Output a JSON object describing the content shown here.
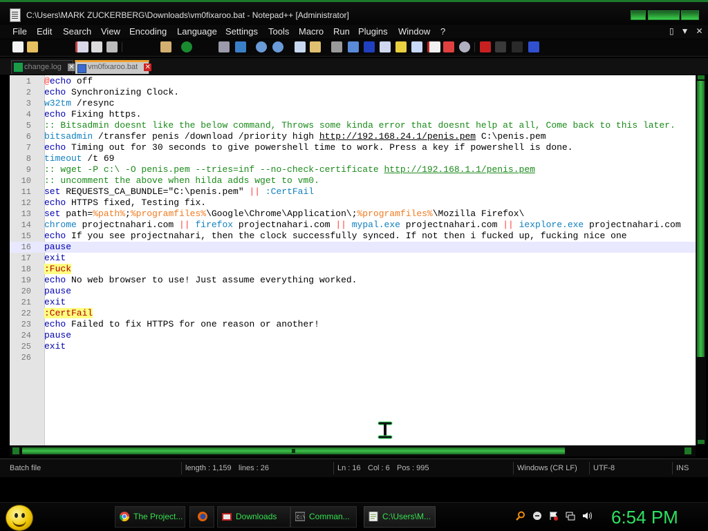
{
  "window": {
    "title": "C:\\Users\\MARK ZUCKERBERG\\Downloads\\vm0fixaroo.bat - Notepad++ [Administrator]"
  },
  "menu": {
    "items": [
      "File",
      "Edit",
      "Search",
      "View",
      "Encoding",
      "Language",
      "Settings",
      "Tools",
      "Macro",
      "Run",
      "Plugins",
      "Window",
      "?"
    ],
    "right_controls": [
      "▯",
      "▼",
      "✕"
    ]
  },
  "tabs": [
    {
      "label": "change.log",
      "active": false
    },
    {
      "label": "vm0fixaroo.bat",
      "active": true
    }
  ],
  "editor": {
    "current_line": 16,
    "lines": [
      "1",
      "2",
      "3",
      "4",
      "5",
      "6",
      "7",
      "8",
      "9",
      "10",
      "11",
      "12",
      "13",
      "14",
      "15",
      "16",
      "17",
      "18",
      "19",
      "20",
      "21",
      "22",
      "23",
      "24",
      "25",
      "26"
    ],
    "code": {
      "l1": [
        "@",
        "echo",
        " off"
      ],
      "l2": [
        "echo",
        " Synchronizing Clock."
      ],
      "l3": [
        "w32tm",
        " /resync"
      ],
      "l4": [
        "echo",
        " Fixing https."
      ],
      "l5": ":: Bitsadmin doesnt like the below command, Throws some kinda error that doesnt help at all, Come back to this later.",
      "l6": [
        "bitsadmin",
        " /transfer penis /download /priority high ",
        "http://192.168.24.1/penis.pem",
        " C:\\penis.pem"
      ],
      "l7": [
        "echo",
        " Timing out for 30 seconds to give powershell time to work. Press a key if powershell is done."
      ],
      "l8": [
        "timeout",
        " /t 69"
      ],
      "l9": [
        ":: wget -P c:\\ -O penis.pem --tries=inf --no-check-certificate ",
        "http://192.168.1.1/penis.pem"
      ],
      "l10": ":: uncomment the above when hilda adds wget to vm0.",
      "l11": [
        "set",
        " REQUESTS_CA_BUNDLE=\"C:\\penis.pem\" ",
        "||",
        " ",
        ":CertFail"
      ],
      "l12": [
        "echo",
        " HTTPS fixed, Testing fix."
      ],
      "l13": [
        "set",
        " path=",
        "%path%",
        ";",
        "%programfiles%",
        "\\Google\\Chrome\\Application\\;",
        "%programfiles%",
        "\\Mozilla Firefox\\"
      ],
      "l14": [
        "chrome",
        " projectnahari.com ",
        "||",
        " ",
        "firefox",
        " projectnahari.com ",
        "||",
        " ",
        "mypal.exe",
        " projectnahari.com ",
        "||",
        " ",
        "iexplore.exe",
        " projectnahari.com"
      ],
      "l15": [
        "echo",
        " If you see projectnahari, then the clock successfully synced. If not then i fucked up, fucking nice one"
      ],
      "l16": "pause",
      "l17": "exit",
      "l18": ":Fuck",
      "l19": [
        "echo",
        " No web browser to use! Just assume everything worked."
      ],
      "l20": "pause",
      "l21": "exit",
      "l22": ":CertFail",
      "l23": [
        "echo",
        " Failed to fix HTTPS for one reason or another!"
      ],
      "l24": "pause",
      "l25": "exit",
      "l26": ""
    }
  },
  "statusbar": {
    "file_type": "Batch file",
    "length": "length : 1,159",
    "lines": "lines : 26",
    "ln": "Ln : 16",
    "col": "Col : 6",
    "pos": "Pos : 995",
    "eol": "Windows (CR LF)",
    "encoding": "UTF-8",
    "mode": "INS"
  },
  "taskbar": {
    "tasks": [
      {
        "label": "The Project...",
        "icon": "chrome-icon"
      },
      {
        "label": "",
        "icon": "firefox-icon"
      },
      {
        "label": "Downloads",
        "icon": "folder-icon"
      },
      {
        "label": "Comman...",
        "icon": "cmd-icon"
      },
      {
        "label": "C:\\Users\\M...",
        "icon": "notepadpp-icon"
      }
    ],
    "clock": "6:54 PM"
  },
  "colors": {
    "accent_green": "#2ee060",
    "keyword_blue": "#0000b0",
    "comment_green": "#1a8a1a",
    "operator_red": "#ff3c3c",
    "label_bg": "#ffff80"
  }
}
